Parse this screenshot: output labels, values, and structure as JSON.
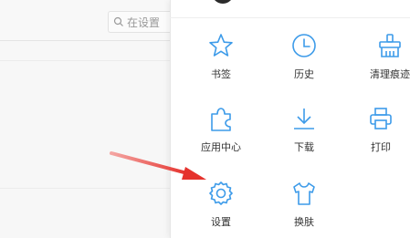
{
  "search": {
    "text": "在设置"
  },
  "menu": {
    "items": [
      {
        "id": "bookmarks",
        "label": "书签",
        "icon": "star-icon"
      },
      {
        "id": "history",
        "label": "历史",
        "icon": "clock-icon"
      },
      {
        "id": "clear",
        "label": "清理痕迹",
        "icon": "broom-icon"
      },
      {
        "id": "apps",
        "label": "应用中心",
        "icon": "puzzle-icon"
      },
      {
        "id": "downloads",
        "label": "下载",
        "icon": "download-icon"
      },
      {
        "id": "print",
        "label": "打印",
        "icon": "printer-icon"
      },
      {
        "id": "settings",
        "label": "设置",
        "icon": "gear-icon"
      },
      {
        "id": "skin",
        "label": "换肤",
        "icon": "tshirt-icon"
      }
    ]
  },
  "colors": {
    "icon": "#3d9be9",
    "arrow": "#e5322d"
  }
}
